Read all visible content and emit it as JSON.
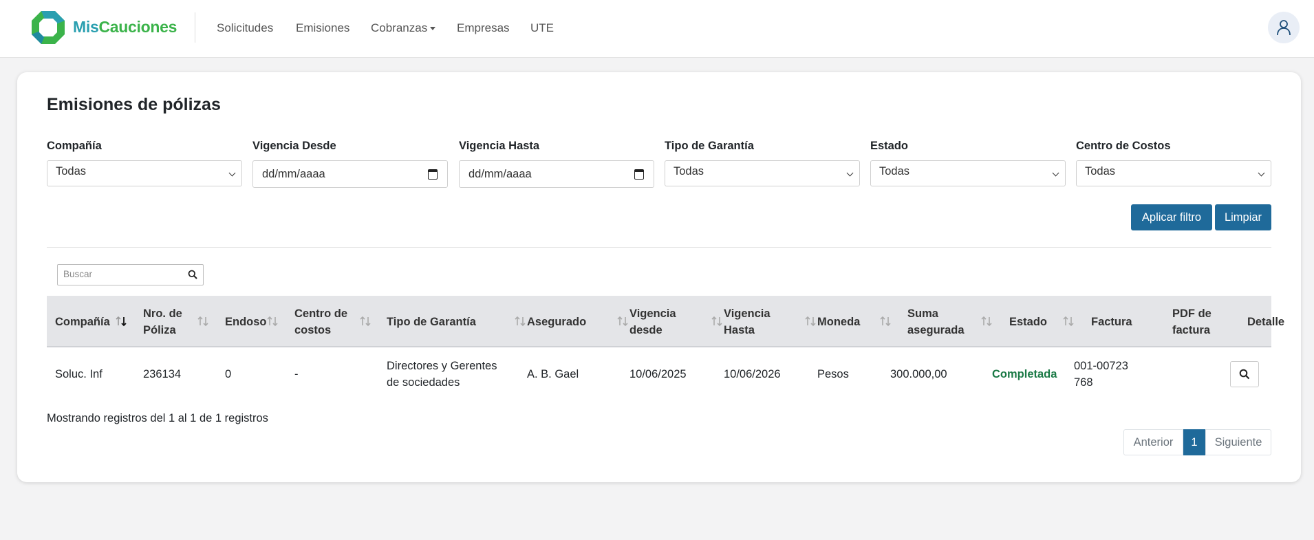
{
  "brand": {
    "part1": "Mis",
    "part2": "Cauciones"
  },
  "nav": {
    "items": [
      "Solicitudes",
      "Emisiones",
      "Cobranzas",
      "Empresas",
      "UTE"
    ]
  },
  "page": {
    "title": "Emisiones de pólizas"
  },
  "filters": {
    "compania": {
      "label": "Compañía",
      "value": "Todas"
    },
    "vigencia_desde": {
      "label": "Vigencia Desde",
      "placeholder": "dd/mm/aaaa"
    },
    "vigencia_hasta": {
      "label": "Vigencia Hasta",
      "placeholder": "dd/mm/aaaa"
    },
    "tipo_garantia": {
      "label": "Tipo de Garantía",
      "value": "Todas"
    },
    "estado": {
      "label": "Estado",
      "value": "Todas"
    },
    "centro_costos": {
      "label": "Centro de Costos",
      "value": "Todas"
    },
    "apply_label": "Aplicar filtro",
    "clear_label": "Limpiar"
  },
  "search": {
    "placeholder": "Buscar"
  },
  "table": {
    "columns": [
      "Compañía",
      "Nro. de Póliza",
      "Endoso",
      "Centro de costos",
      "Tipo de Garantía",
      "Asegurado",
      "Vigencia desde",
      "Vigencia Hasta",
      "Moneda",
      "Suma asegurada",
      "Estado",
      "Factura",
      "PDF de factura",
      "Detalle"
    ],
    "rows": [
      {
        "compania": "Soluc. Inf",
        "poliza": "236134",
        "endoso": "0",
        "centro": "-",
        "tipo": "Directores y Gerentes de sociedades",
        "asegurado": "A. B. Gael",
        "desde": "10/06/2025",
        "hasta": "10/06/2026",
        "moneda": "Pesos",
        "suma": "300.000,00",
        "estado": "Completada",
        "factura": "001-00723768"
      }
    ],
    "info": "Mostrando registros del 1 al 1 de 1 registros"
  },
  "pagination": {
    "prev": "Anterior",
    "current": "1",
    "next": "Siguiente"
  },
  "colors": {
    "primary": "#1f6a9a",
    "status_ok": "#1b7a46",
    "brand_teal": "#2a9fb0",
    "brand_green": "#3bb34a"
  }
}
